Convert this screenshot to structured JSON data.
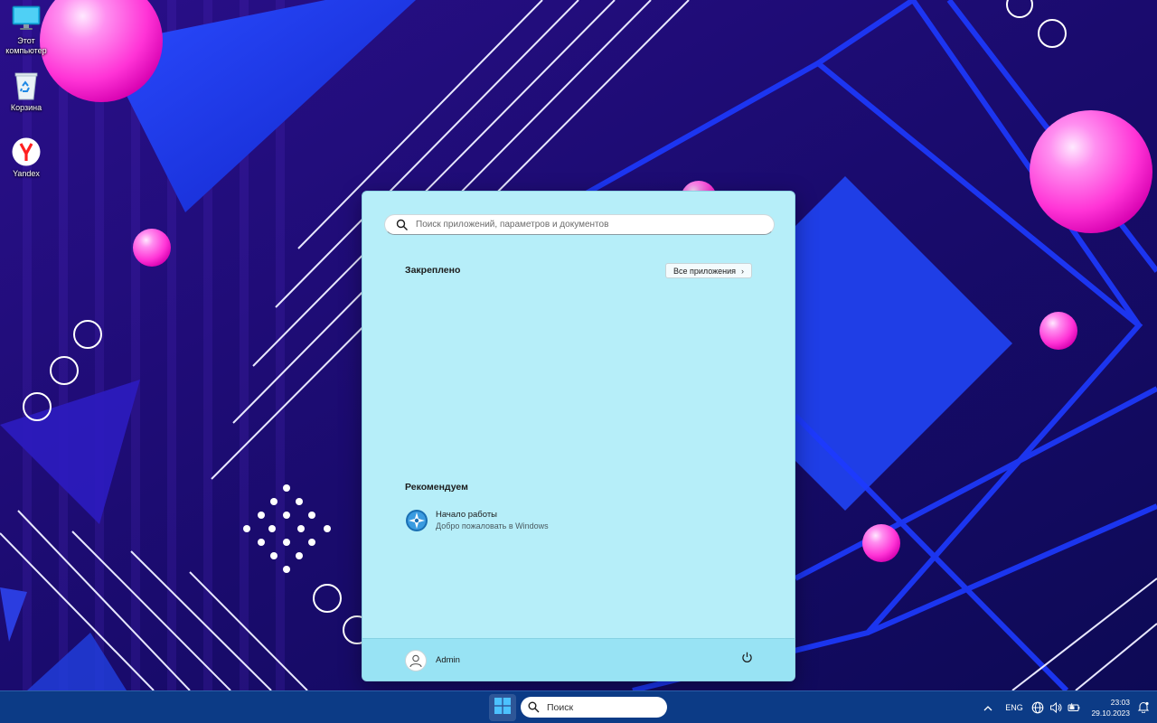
{
  "desktop": {
    "icons": [
      {
        "name": "this-pc",
        "label": "Этот компьютер",
        "icon": "monitor-icon"
      },
      {
        "name": "recycle-bin",
        "label": "Корзина",
        "icon": "recycle-bin-icon"
      },
      {
        "name": "yandex",
        "label": "Yandex",
        "icon": "yandex-browser-icon"
      }
    ]
  },
  "start_menu": {
    "search_placeholder": "Поиск приложений, параметров и документов",
    "pinned_title": "Закреплено",
    "all_apps_label": "Все приложения",
    "recommended_title": "Рекомендуем",
    "recommended": [
      {
        "title": "Начало работы",
        "subtitle": "Добро пожаловать в Windows",
        "icon": "get-started-icon"
      }
    ],
    "user_name": "Admin",
    "power_icon": "power-icon"
  },
  "taskbar": {
    "search_label": "Поиск",
    "language": "ENG",
    "time": "23:03",
    "date": "29.10.2023",
    "tray_icons": [
      "chevron-up-icon",
      "network-icon",
      "volume-icon",
      "battery-icon",
      "notification-icon"
    ]
  },
  "colors": {
    "start_bg": "#b6eef9",
    "start_footer": "#98e3f4",
    "taskbar": "#0c3b86",
    "wallpaper_base": "#1a0e6b",
    "accent_pink": "#ff3bd8"
  }
}
